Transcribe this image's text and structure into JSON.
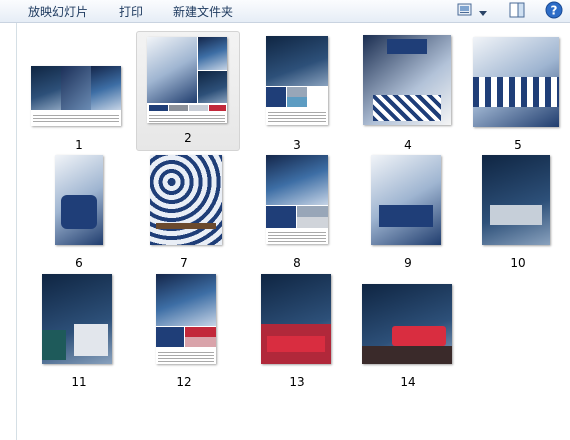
{
  "toolbar": {
    "slideshow_label": "放映幻灯片",
    "print_label": "打印",
    "new_folder_label": "新建文件夹"
  },
  "items": [
    {
      "label": "1"
    },
    {
      "label": "2"
    },
    {
      "label": "3"
    },
    {
      "label": "4"
    },
    {
      "label": "5"
    },
    {
      "label": "6"
    },
    {
      "label": "7"
    },
    {
      "label": "8"
    },
    {
      "label": "9"
    },
    {
      "label": "10"
    },
    {
      "label": "11"
    },
    {
      "label": "12"
    },
    {
      "label": "13"
    },
    {
      "label": "14"
    }
  ],
  "colors": {
    "accent_blue": "#1f3e78",
    "accent_red": "#c2283a"
  }
}
